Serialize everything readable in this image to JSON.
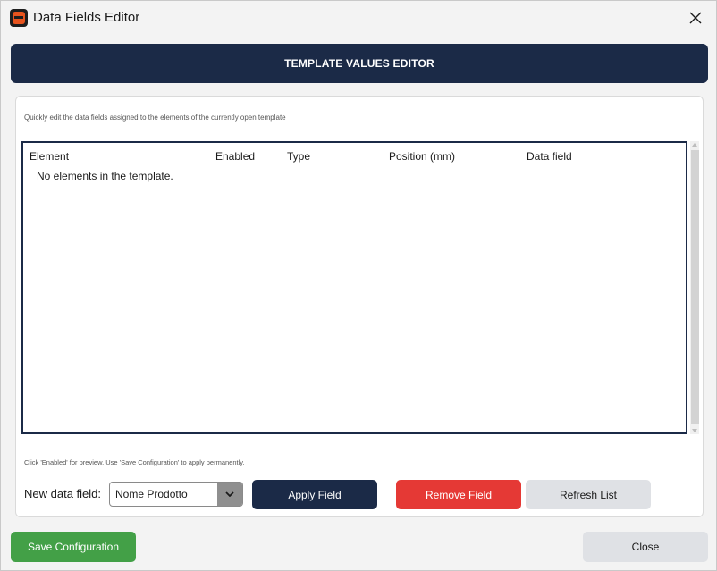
{
  "window": {
    "title": "Data Fields Editor"
  },
  "header": {
    "title": "TEMPLATE VALUES EDITOR"
  },
  "panel": {
    "hint_top": "Quickly edit the data fields assigned to the elements of the currently open template",
    "hint_bottom": "Click 'Enabled' for preview. Use 'Save Configuration' to apply permanently."
  },
  "table": {
    "columns": [
      "Element",
      "Enabled",
      "Type",
      "Position (mm)",
      "Data field"
    ],
    "empty_message": "No elements in the template."
  },
  "controls": {
    "new_field_label": "New data field:",
    "new_field_value": "Nome Prodotto",
    "apply_label": "Apply Field",
    "remove_label": "Remove Field",
    "refresh_label": "Refresh List"
  },
  "footer": {
    "save_label": "Save Configuration",
    "close_label": "Close"
  },
  "colors": {
    "navy": "#1b2a47",
    "red": "#e53935",
    "green": "#43a047",
    "gray_button": "#dfe1e5"
  },
  "icons": {
    "app": "app-logo-icon",
    "close": "close-icon",
    "dropdown": "chevron-down-icon"
  }
}
